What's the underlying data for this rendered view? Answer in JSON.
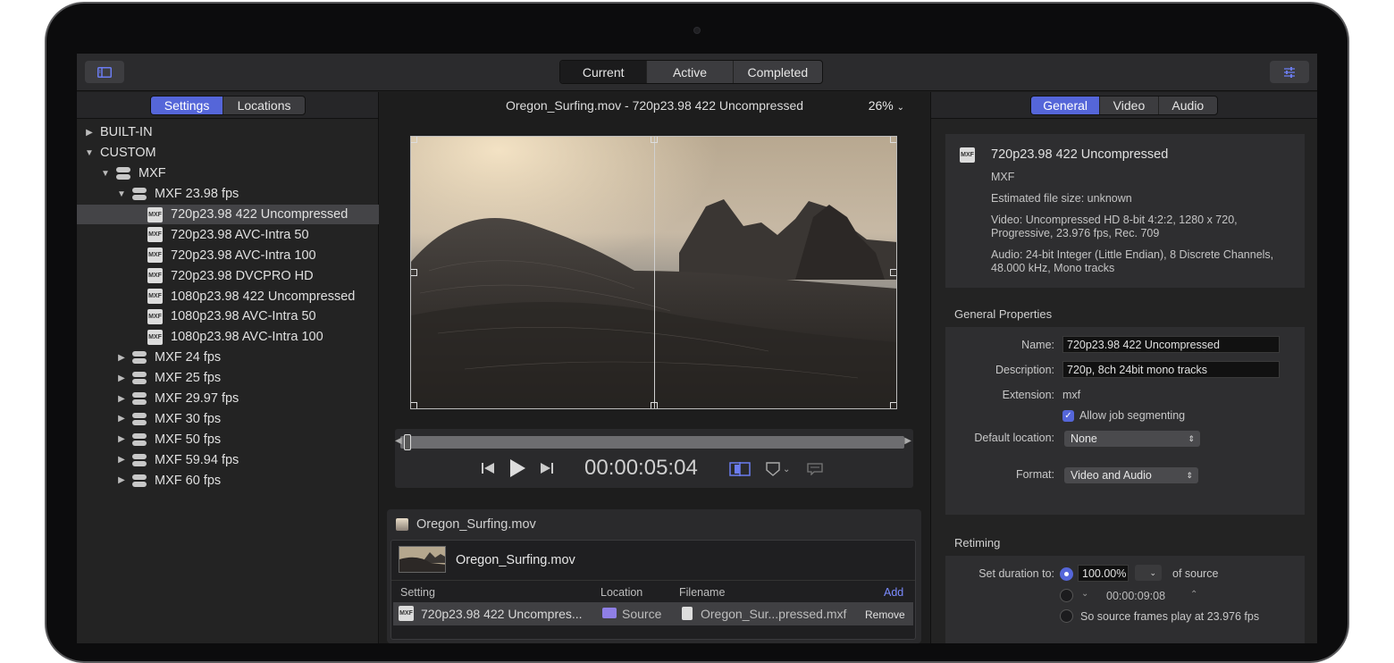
{
  "toolbar": {
    "segments": [
      "Current",
      "Active",
      "Completed"
    ],
    "active_segment": "Current"
  },
  "left": {
    "tabs": [
      "Settings",
      "Locations"
    ],
    "tree": [
      {
        "label": "BUILT-IN",
        "level": 0,
        "type": "folder",
        "open": false
      },
      {
        "label": "CUSTOM",
        "level": 0,
        "type": "folder",
        "open": true
      },
      {
        "label": "MXF",
        "level": 1,
        "type": "group",
        "open": true
      },
      {
        "label": "MXF 23.98 fps",
        "level": 2,
        "type": "group",
        "open": true
      },
      {
        "label": "720p23.98 422 Uncompressed",
        "level": 3,
        "type": "mxf",
        "selected": true
      },
      {
        "label": "720p23.98 AVC-Intra 50",
        "level": 3,
        "type": "mxf"
      },
      {
        "label": "720p23.98 AVC-Intra 100",
        "level": 3,
        "type": "mxf"
      },
      {
        "label": "720p23.98 DVCPRO HD",
        "level": 3,
        "type": "mxf"
      },
      {
        "label": "1080p23.98 422 Uncompressed",
        "level": 3,
        "type": "mxf"
      },
      {
        "label": "1080p23.98 AVC-Intra 50",
        "level": 3,
        "type": "mxf"
      },
      {
        "label": "1080p23.98 AVC-Intra 100",
        "level": 3,
        "type": "mxf"
      },
      {
        "label": "MXF 24 fps",
        "level": 2,
        "type": "group",
        "open": false
      },
      {
        "label": "MXF 25 fps",
        "level": 2,
        "type": "group",
        "open": false
      },
      {
        "label": "MXF 29.97 fps",
        "level": 2,
        "type": "group",
        "open": false
      },
      {
        "label": "MXF 30 fps",
        "level": 2,
        "type": "group",
        "open": false
      },
      {
        "label": "MXF 50 fps",
        "level": 2,
        "type": "group",
        "open": false
      },
      {
        "label": "MXF 59.94 fps",
        "level": 2,
        "type": "group",
        "open": false
      },
      {
        "label": "MXF 60 fps",
        "level": 2,
        "type": "group",
        "open": false
      }
    ]
  },
  "viewer": {
    "title": "Oregon_Surfing.mov - 720p23.98 422 Uncompressed",
    "zoom": "26%",
    "timecode": "00:00:05:04"
  },
  "batch": {
    "header": "Oregon_Surfing.mov",
    "source_name": "Oregon_Surfing.mov",
    "columns": {
      "setting": "Setting",
      "location": "Location",
      "filename": "Filename",
      "add": "Add"
    },
    "job": {
      "setting": "720p23.98 422 Uncompres...",
      "location": "Source",
      "filename": "Oregon_Sur...pressed.mxf",
      "remove": "Remove"
    }
  },
  "inspector": {
    "tabs": [
      "General",
      "Video",
      "Audio"
    ],
    "summary": {
      "name": "720p23.98 422 Uncompressed",
      "format": "MXF",
      "size": "Estimated file size: unknown",
      "video_line1": "Video: Uncompressed HD 8-bit 4:2:2, 1280 x 720,",
      "video_line2": "Progressive, 23.976 fps, Rec. 709",
      "audio_line1": "Audio: 24-bit Integer (Little Endian), 8 Discrete Channels,",
      "audio_line2": "48.000 kHz, Mono tracks"
    },
    "general": {
      "title": "General Properties",
      "name_label": "Name:",
      "name_value": "720p23.98 422 Uncompressed",
      "desc_label": "Description:",
      "desc_value": "720p, 8ch 24bit mono tracks",
      "ext_label": "Extension:",
      "ext_value": "mxf",
      "segment_label": "Allow job segmenting",
      "location_label": "Default location:",
      "location_value": "None",
      "format_label": "Format:",
      "format_value": "Video and Audio"
    },
    "retiming": {
      "title": "Retiming",
      "duration_label": "Set duration to:",
      "percent": "100.00%",
      "of_source": "of source",
      "duration_tc": "00:00:09:08",
      "frames_label": "So source frames play at 23.976 fps"
    }
  }
}
